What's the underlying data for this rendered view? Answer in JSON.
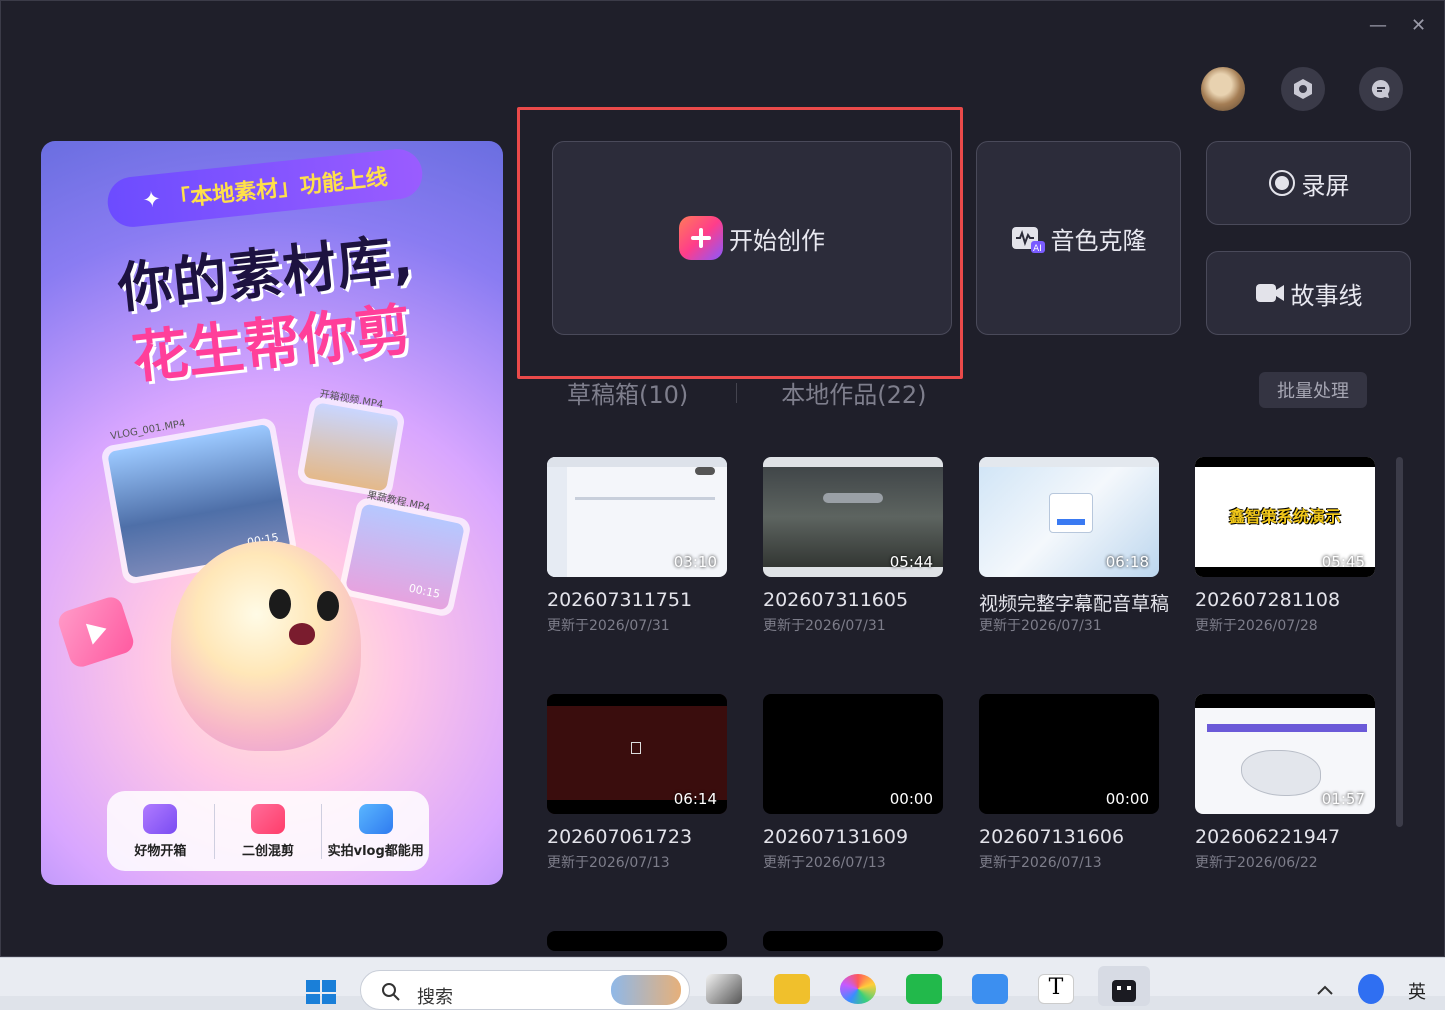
{
  "window": {
    "minimize": "—",
    "close": "✕"
  },
  "header": {
    "avatar": "avatar",
    "settings_icon": "hexagon-settings-icon",
    "message_icon": "message-icon"
  },
  "banner": {
    "tag": "「本地素材」功能上线",
    "line1": "你的素材库,",
    "line2": "花生帮你剪",
    "cards": [
      {
        "name": "VLOG_001.MP4",
        "duration": "00:15"
      },
      {
        "name": "开箱视频.MP4",
        "duration": ""
      },
      {
        "name": "果蔬教程.MP4",
        "duration": "00:15"
      }
    ],
    "bottom": [
      "好物开箱",
      "二创混剪",
      "实拍vlog都能用"
    ]
  },
  "actions": {
    "start": "开始创作",
    "voice_clone": "音色克隆",
    "record": "录屏",
    "storyline": "故事线"
  },
  "tabs": {
    "drafts": "草稿箱(10)",
    "local": "本地作品(22)"
  },
  "batch": "批量处理",
  "drafts": [
    {
      "title": "202607311751",
      "date": "更新于2026/07/31",
      "duration": "03:10"
    },
    {
      "title": "202607311605",
      "date": "更新于2026/07/31",
      "duration": "05:44"
    },
    {
      "title": "视频完整字幕配音草稿",
      "date": "更新于2026/07/31",
      "duration": "06:18"
    },
    {
      "title": "202607281108",
      "date": "更新于2026/07/28",
      "duration": "05:45"
    },
    {
      "title": "202607061723",
      "date": "更新于2026/07/13",
      "duration": "06:14"
    },
    {
      "title": "202607131609",
      "date": "更新于2026/07/13",
      "duration": "00:00"
    },
    {
      "title": "202607131606",
      "date": "更新于2026/07/13",
      "duration": "00:00"
    },
    {
      "title": "202606221947",
      "date": "更新于2026/06/22",
      "duration": "01:57"
    }
  ],
  "thumb_text": {
    "t4": "鑫智策系统演示"
  },
  "taskbar": {
    "search": "搜索",
    "ime": "英"
  },
  "colors": {
    "accent_red": "#ea4a4a",
    "bg": "#1f1f2a",
    "card": "#2c2c3a"
  }
}
